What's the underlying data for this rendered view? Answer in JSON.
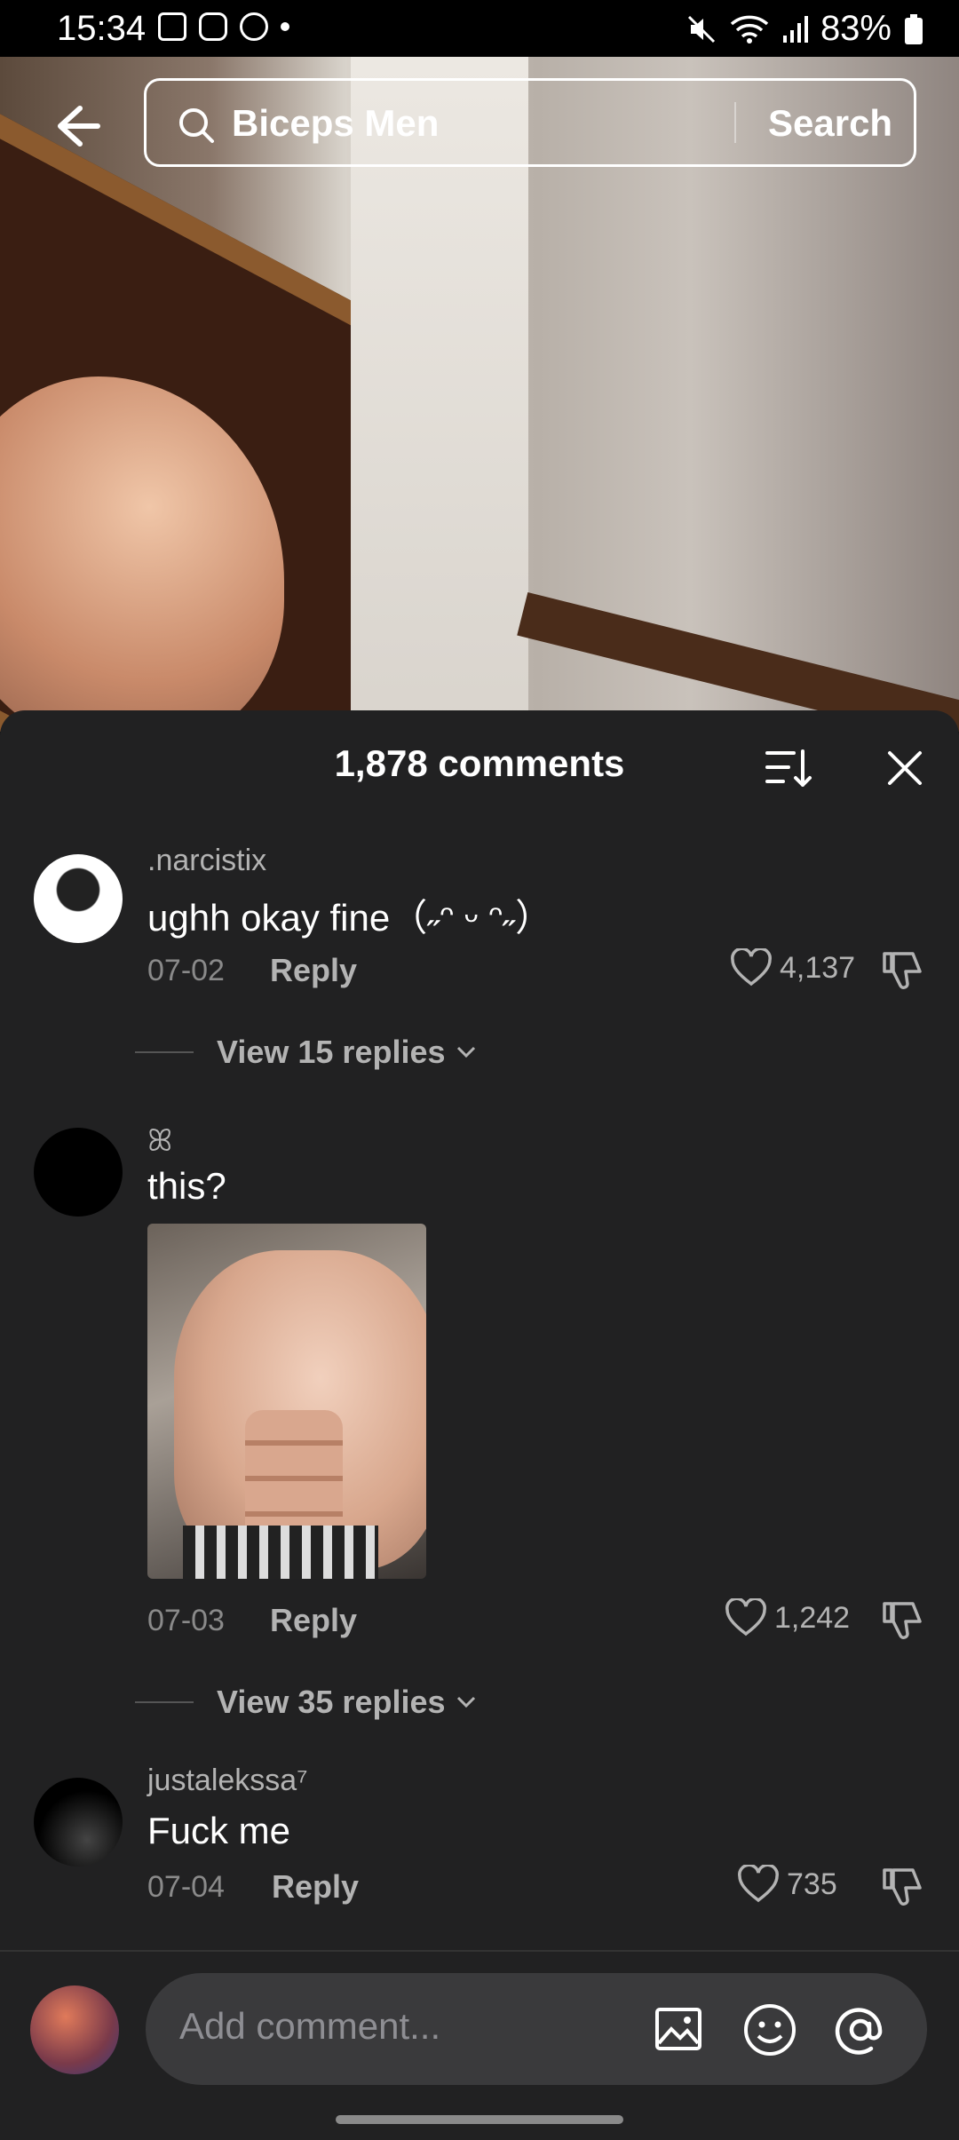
{
  "status_bar": {
    "time": "15:34",
    "battery": "83%"
  },
  "search": {
    "query": "Biceps Men",
    "button_label": "Search"
  },
  "comments_panel": {
    "title": "1,878 comments",
    "comments": [
      {
        "username": ".narcistix",
        "text": "ughh okay fine（˶ᵔ ᵕ ᵔ˶）",
        "date": "07-02",
        "reply_label": "Reply",
        "likes": "4,137",
        "view_replies": "View 15 replies"
      },
      {
        "username": "ꕤ",
        "text": "this?",
        "date": "07-03",
        "reply_label": "Reply",
        "likes": "1,242",
        "view_replies": "View 35 replies"
      },
      {
        "username": "justalekssa⁷",
        "text": "Fuck me",
        "date": "07-04",
        "reply_label": "Reply",
        "likes": "735"
      }
    ]
  },
  "composer": {
    "placeholder": "Add comment..."
  }
}
